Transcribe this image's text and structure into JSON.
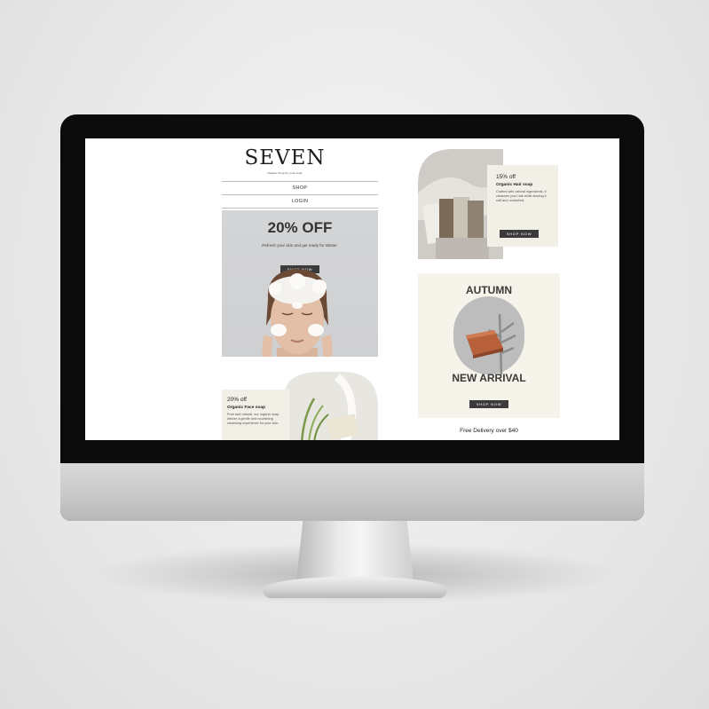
{
  "brand": {
    "logo": "SEVEN",
    "tagline": "Organic Soap for your body"
  },
  "nav": {
    "items": [
      {
        "label": "SHOP"
      },
      {
        "label": "LOGIN"
      }
    ]
  },
  "hero": {
    "title": "20% OFF",
    "subtitle": "Refresh your skin and get ready for Winter.",
    "button": "SHOP NOW"
  },
  "face_soap": {
    "discount": "20% off",
    "name": "Organic Face soap",
    "description": "Pure and natural, our organic soap deliver a gentle and nourishing cleansing experience for your skin."
  },
  "hair_soap": {
    "discount": "15% off",
    "name": "Organic Hair soap",
    "description": "Crafted with natural ingredients, it cleanses your hair while leaving it soft and nourished.",
    "button": "SHOP NOW"
  },
  "autumn": {
    "title_top": "AUTUMN",
    "title_bottom": "NEW ARRIVAL",
    "button": "SHOP NOW"
  },
  "footer": {
    "delivery": "Free Delivery over $40"
  },
  "colors": {
    "button": "#3b3b3b",
    "card_bg": "#f1efe6",
    "autumn_bg": "#f6f4ea",
    "soap_accent": "#b8603a"
  }
}
